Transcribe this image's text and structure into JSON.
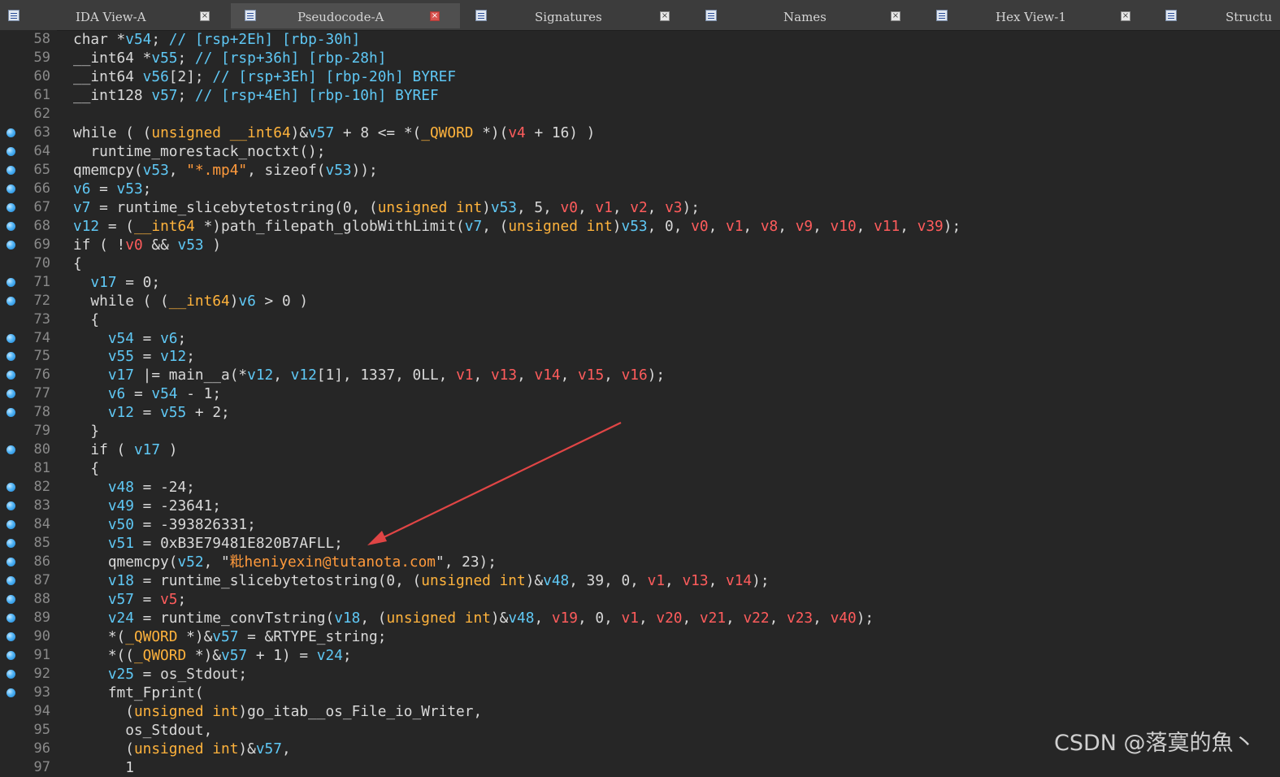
{
  "tabs": [
    {
      "label": "IDA View-A",
      "icon": "disassembly-icon",
      "active": false,
      "closable": true
    },
    {
      "label": "Pseudocode-A",
      "icon": "pseudocode-icon",
      "active": true,
      "closable": true
    },
    {
      "label": "Signatures",
      "icon": "signatures-icon",
      "active": false,
      "closable": true
    },
    {
      "label": "Names",
      "icon": "names-icon",
      "active": false,
      "closable": true
    },
    {
      "label": "Hex View-1",
      "icon": "hex-view-icon",
      "active": false,
      "closable": true
    },
    {
      "label": "Structu",
      "icon": "structures-icon",
      "active": false,
      "closable": false
    }
  ],
  "colors": {
    "background": "#262626",
    "variable": "#5fc8f5",
    "register_var": "#ff5c5c",
    "type_keyword": "#ffb33c",
    "string": "#ff9a3c",
    "arrow": "#e04545"
  },
  "code_lines": [
    {
      "n": "58",
      "bp": false,
      "t": [
        [
          "p",
          "char *"
        ],
        [
          "v",
          "v54"
        ],
        [
          "p",
          "; "
        ],
        [
          "c",
          "// [rsp+2Eh] [rbp-30h]"
        ]
      ]
    },
    {
      "n": "59",
      "bp": false,
      "t": [
        [
          "p",
          "__int64 *"
        ],
        [
          "v",
          "v55"
        ],
        [
          "p",
          "; "
        ],
        [
          "c",
          "// [rsp+36h] [rbp-28h]"
        ]
      ]
    },
    {
      "n": "60",
      "bp": false,
      "t": [
        [
          "p",
          "__int64 "
        ],
        [
          "v",
          "v56"
        ],
        [
          "p",
          "[2]; "
        ],
        [
          "c",
          "// [rsp+3Eh] [rbp-20h] BYREF"
        ]
      ]
    },
    {
      "n": "61",
      "bp": false,
      "t": [
        [
          "p",
          "__int128 "
        ],
        [
          "v",
          "v57"
        ],
        [
          "p",
          "; "
        ],
        [
          "c",
          "// [rsp+4Eh] [rbp-10h] BYREF"
        ]
      ]
    },
    {
      "n": "62",
      "bp": false,
      "t": []
    },
    {
      "n": "63",
      "bp": true,
      "t": [
        [
          "p",
          "while ( ("
        ],
        [
          "k",
          "unsigned __int64"
        ],
        [
          "p",
          ")&"
        ],
        [
          "v",
          "v57"
        ],
        [
          "p",
          " + 8 <= *("
        ],
        [
          "k",
          "_QWORD"
        ],
        [
          "p",
          " *)("
        ],
        [
          "r",
          "v4"
        ],
        [
          "p",
          " + 16) )"
        ]
      ]
    },
    {
      "n": "64",
      "bp": true,
      "t": [
        [
          "p",
          "  runtime_morestack_noctxt();"
        ]
      ]
    },
    {
      "n": "65",
      "bp": true,
      "t": [
        [
          "p",
          "qmemcpy("
        ],
        [
          "v",
          "v53"
        ],
        [
          "p",
          ", "
        ],
        [
          "s",
          "\"*.mp4\""
        ],
        [
          "p",
          ", sizeof("
        ],
        [
          "v",
          "v53"
        ],
        [
          "p",
          "));"
        ]
      ]
    },
    {
      "n": "66",
      "bp": true,
      "t": [
        [
          "v",
          "v6"
        ],
        [
          "p",
          " = "
        ],
        [
          "v",
          "v53"
        ],
        [
          "p",
          ";"
        ]
      ]
    },
    {
      "n": "67",
      "bp": true,
      "t": [
        [
          "v",
          "v7"
        ],
        [
          "p",
          " = runtime_slicebytetostring(0, ("
        ],
        [
          "k",
          "unsigned int"
        ],
        [
          "p",
          ")"
        ],
        [
          "v",
          "v53"
        ],
        [
          "p",
          ", 5, "
        ],
        [
          "r",
          "v0"
        ],
        [
          "p",
          ", "
        ],
        [
          "r",
          "v1"
        ],
        [
          "p",
          ", "
        ],
        [
          "r",
          "v2"
        ],
        [
          "p",
          ", "
        ],
        [
          "r",
          "v3"
        ],
        [
          "p",
          ");"
        ]
      ]
    },
    {
      "n": "68",
      "bp": true,
      "t": [
        [
          "v",
          "v12"
        ],
        [
          "p",
          " = ("
        ],
        [
          "k",
          "__int64"
        ],
        [
          "p",
          " *)path_filepath_globWithLimit("
        ],
        [
          "v",
          "v7"
        ],
        [
          "p",
          ", ("
        ],
        [
          "k",
          "unsigned int"
        ],
        [
          "p",
          ")"
        ],
        [
          "v",
          "v53"
        ],
        [
          "p",
          ", 0, "
        ],
        [
          "r",
          "v0"
        ],
        [
          "p",
          ", "
        ],
        [
          "r",
          "v1"
        ],
        [
          "p",
          ", "
        ],
        [
          "r",
          "v8"
        ],
        [
          "p",
          ", "
        ],
        [
          "r",
          "v9"
        ],
        [
          "p",
          ", "
        ],
        [
          "r",
          "v10"
        ],
        [
          "p",
          ", "
        ],
        [
          "r",
          "v11"
        ],
        [
          "p",
          ", "
        ],
        [
          "r",
          "v39"
        ],
        [
          "p",
          ");"
        ]
      ]
    },
    {
      "n": "69",
      "bp": true,
      "t": [
        [
          "p",
          "if ( !"
        ],
        [
          "r",
          "v0"
        ],
        [
          "p",
          " && "
        ],
        [
          "v",
          "v53"
        ],
        [
          "p",
          " )"
        ]
      ]
    },
    {
      "n": "70",
      "bp": false,
      "t": [
        [
          "p",
          "{"
        ]
      ]
    },
    {
      "n": "71",
      "bp": true,
      "t": [
        [
          "p",
          "  "
        ],
        [
          "v",
          "v17"
        ],
        [
          "p",
          " = 0;"
        ]
      ]
    },
    {
      "n": "72",
      "bp": true,
      "t": [
        [
          "p",
          "  while ( ("
        ],
        [
          "k",
          "__int64"
        ],
        [
          "p",
          ")"
        ],
        [
          "v",
          "v6"
        ],
        [
          "p",
          " > 0 )"
        ]
      ]
    },
    {
      "n": "73",
      "bp": false,
      "t": [
        [
          "p",
          "  {"
        ]
      ]
    },
    {
      "n": "74",
      "bp": true,
      "t": [
        [
          "p",
          "    "
        ],
        [
          "v",
          "v54"
        ],
        [
          "p",
          " = "
        ],
        [
          "v",
          "v6"
        ],
        [
          "p",
          ";"
        ]
      ]
    },
    {
      "n": "75",
      "bp": true,
      "t": [
        [
          "p",
          "    "
        ],
        [
          "v",
          "v55"
        ],
        [
          "p",
          " = "
        ],
        [
          "v",
          "v12"
        ],
        [
          "p",
          ";"
        ]
      ]
    },
    {
      "n": "76",
      "bp": true,
      "t": [
        [
          "p",
          "    "
        ],
        [
          "v",
          "v17"
        ],
        [
          "p",
          " |= main__a(*"
        ],
        [
          "v",
          "v12"
        ],
        [
          "p",
          ", "
        ],
        [
          "v",
          "v12"
        ],
        [
          "p",
          "[1], 1337, 0LL, "
        ],
        [
          "r",
          "v1"
        ],
        [
          "p",
          ", "
        ],
        [
          "r",
          "v13"
        ],
        [
          "p",
          ", "
        ],
        [
          "r",
          "v14"
        ],
        [
          "p",
          ", "
        ],
        [
          "r",
          "v15"
        ],
        [
          "p",
          ", "
        ],
        [
          "r",
          "v16"
        ],
        [
          "p",
          ");"
        ]
      ]
    },
    {
      "n": "77",
      "bp": true,
      "t": [
        [
          "p",
          "    "
        ],
        [
          "v",
          "v6"
        ],
        [
          "p",
          " = "
        ],
        [
          "v",
          "v54"
        ],
        [
          "p",
          " - 1;"
        ]
      ]
    },
    {
      "n": "78",
      "bp": true,
      "t": [
        [
          "p",
          "    "
        ],
        [
          "v",
          "v12"
        ],
        [
          "p",
          " = "
        ],
        [
          "v",
          "v55"
        ],
        [
          "p",
          " + 2;"
        ]
      ]
    },
    {
      "n": "79",
      "bp": false,
      "t": [
        [
          "p",
          "  }"
        ]
      ]
    },
    {
      "n": "80",
      "bp": true,
      "t": [
        [
          "p",
          "  if ( "
        ],
        [
          "v",
          "v17"
        ],
        [
          "p",
          " )"
        ]
      ]
    },
    {
      "n": "81",
      "bp": false,
      "t": [
        [
          "p",
          "  {"
        ]
      ]
    },
    {
      "n": "82",
      "bp": true,
      "t": [
        [
          "p",
          "    "
        ],
        [
          "v",
          "v48"
        ],
        [
          "p",
          " = -24;"
        ]
      ]
    },
    {
      "n": "83",
      "bp": true,
      "t": [
        [
          "p",
          "    "
        ],
        [
          "v",
          "v49"
        ],
        [
          "p",
          " = -23641;"
        ]
      ]
    },
    {
      "n": "84",
      "bp": true,
      "t": [
        [
          "p",
          "    "
        ],
        [
          "v",
          "v50"
        ],
        [
          "p",
          " = -393826331;"
        ]
      ]
    },
    {
      "n": "85",
      "bp": true,
      "t": [
        [
          "p",
          "    "
        ],
        [
          "v",
          "v51"
        ],
        [
          "p",
          " = 0xB3E79481E820B7AFLL;"
        ]
      ]
    },
    {
      "n": "86",
      "bp": true,
      "t": [
        [
          "p",
          "    qmemcpy("
        ],
        [
          "v",
          "v52"
        ],
        [
          "p",
          ", \""
        ],
        [
          "s",
          "粃heniyexin@tutanota.com"
        ],
        [
          "p",
          "\", 23);"
        ]
      ]
    },
    {
      "n": "87",
      "bp": true,
      "t": [
        [
          "p",
          "    "
        ],
        [
          "v",
          "v18"
        ],
        [
          "p",
          " = runtime_slicebytetostring(0, ("
        ],
        [
          "k",
          "unsigned int"
        ],
        [
          "p",
          ")&"
        ],
        [
          "v",
          "v48"
        ],
        [
          "p",
          ", 39, 0, "
        ],
        [
          "r",
          "v1"
        ],
        [
          "p",
          ", "
        ],
        [
          "r",
          "v13"
        ],
        [
          "p",
          ", "
        ],
        [
          "r",
          "v14"
        ],
        [
          "p",
          ");"
        ]
      ]
    },
    {
      "n": "88",
      "bp": true,
      "t": [
        [
          "p",
          "    "
        ],
        [
          "v",
          "v57"
        ],
        [
          "p",
          " = "
        ],
        [
          "r",
          "v5"
        ],
        [
          "p",
          ";"
        ]
      ]
    },
    {
      "n": "89",
      "bp": true,
      "t": [
        [
          "p",
          "    "
        ],
        [
          "v",
          "v24"
        ],
        [
          "p",
          " = runtime_convTstring("
        ],
        [
          "v",
          "v18"
        ],
        [
          "p",
          ", ("
        ],
        [
          "k",
          "unsigned int"
        ],
        [
          "p",
          ")&"
        ],
        [
          "v",
          "v48"
        ],
        [
          "p",
          ", "
        ],
        [
          "r",
          "v19"
        ],
        [
          "p",
          ", 0, "
        ],
        [
          "r",
          "v1"
        ],
        [
          "p",
          ", "
        ],
        [
          "r",
          "v20"
        ],
        [
          "p",
          ", "
        ],
        [
          "r",
          "v21"
        ],
        [
          "p",
          ", "
        ],
        [
          "r",
          "v22"
        ],
        [
          "p",
          ", "
        ],
        [
          "r",
          "v23"
        ],
        [
          "p",
          ", "
        ],
        [
          "r",
          "v40"
        ],
        [
          "p",
          ");"
        ]
      ]
    },
    {
      "n": "90",
      "bp": true,
      "t": [
        [
          "p",
          "    *("
        ],
        [
          "k",
          "_QWORD"
        ],
        [
          "p",
          " *)&"
        ],
        [
          "v",
          "v57"
        ],
        [
          "p",
          " = &RTYPE_string;"
        ]
      ]
    },
    {
      "n": "91",
      "bp": true,
      "t": [
        [
          "p",
          "    *(("
        ],
        [
          "k",
          "_QWORD"
        ],
        [
          "p",
          " *)&"
        ],
        [
          "v",
          "v57"
        ],
        [
          "p",
          " + 1) = "
        ],
        [
          "v",
          "v24"
        ],
        [
          "p",
          ";"
        ]
      ]
    },
    {
      "n": "92",
      "bp": true,
      "t": [
        [
          "p",
          "    "
        ],
        [
          "v",
          "v25"
        ],
        [
          "p",
          " = os_Stdout;"
        ]
      ]
    },
    {
      "n": "93",
      "bp": true,
      "t": [
        [
          "p",
          "    fmt_Fprint("
        ]
      ]
    },
    {
      "n": "94",
      "bp": false,
      "t": [
        [
          "p",
          "      ("
        ],
        [
          "k",
          "unsigned int"
        ],
        [
          "p",
          ")go_itab__os_File_io_Writer,"
        ]
      ]
    },
    {
      "n": "95",
      "bp": false,
      "t": [
        [
          "p",
          "      os_Stdout,"
        ]
      ]
    },
    {
      "n": "96",
      "bp": false,
      "t": [
        [
          "p",
          "      ("
        ],
        [
          "k",
          "unsigned int"
        ],
        [
          "p",
          ")&"
        ],
        [
          "v",
          "v57"
        ],
        [
          "p",
          ","
        ]
      ]
    },
    {
      "n": "97",
      "bp": false,
      "t": [
        [
          "p",
          "      1"
        ]
      ]
    }
  ],
  "watermark": "CSDN @落寞的魚丶"
}
